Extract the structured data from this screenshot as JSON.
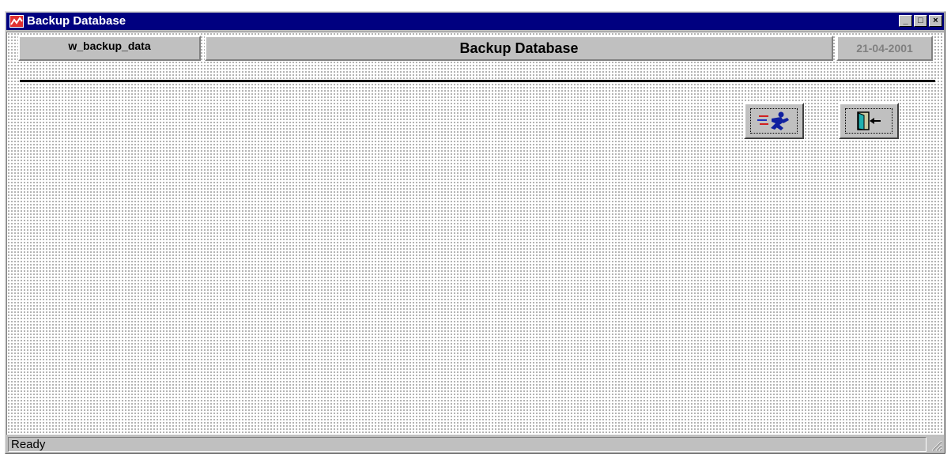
{
  "window": {
    "title": "Backup Database",
    "buttons": {
      "minimize": "_",
      "maximize": "□",
      "close": "×"
    }
  },
  "header": {
    "window_name": "w_backup_data",
    "title": "Backup Database",
    "date": "21-04-2001"
  },
  "toolbar": {
    "run_backup_icon": "running-man-icon",
    "exit_icon": "exit-door-icon"
  },
  "status": {
    "text": "Ready"
  },
  "colors": {
    "titlebar": "#000080",
    "face": "#c0c0c0",
    "date_text": "#808080"
  }
}
